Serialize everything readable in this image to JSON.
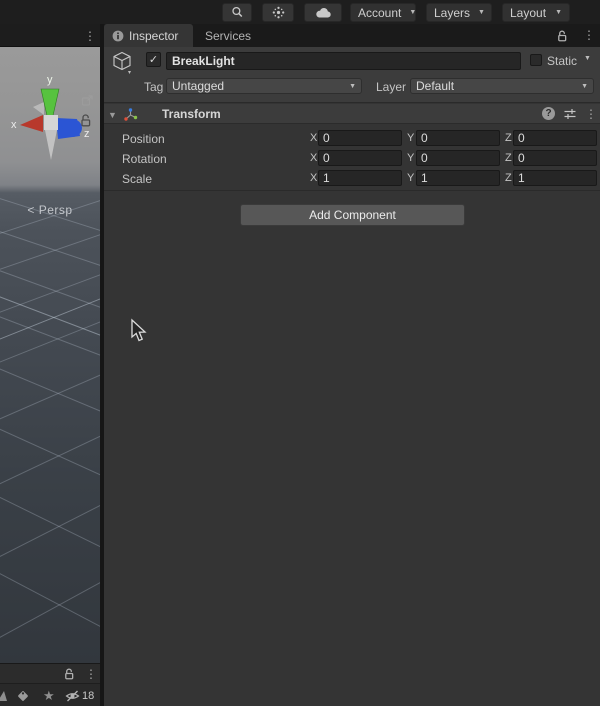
{
  "toolbar": {
    "account_label": "Account",
    "layers_label": "Layers",
    "layout_label": "Layout",
    "dropdown_arrow": "▼"
  },
  "inspector_tabs": {
    "inspector_label": "Inspector",
    "services_label": "Services",
    "kebab": "⋮"
  },
  "gameobject": {
    "check": "✓",
    "name": "BreakLight",
    "static_label": "Static",
    "tag_label": "Tag",
    "tag_value": "Untagged",
    "layer_label": "Layer",
    "layer_value": "Default"
  },
  "transform": {
    "title": "Transform",
    "foldout": "▼",
    "help_glyph": "?",
    "kebab": "⋮",
    "axes": [
      "X",
      "Y",
      "Z"
    ],
    "rows": [
      {
        "label": "Position",
        "values": [
          "0",
          "0",
          "0"
        ]
      },
      {
        "label": "Rotation",
        "values": [
          "0",
          "0",
          "0"
        ]
      },
      {
        "label": "Scale",
        "values": [
          "1",
          "1",
          "1"
        ]
      }
    ]
  },
  "add_component_label": "Add Component",
  "scene": {
    "kebab": "⋮",
    "axis_x_label": "x",
    "axis_y_label": "y",
    "axis_z_label": "z",
    "persp_prefix": "<",
    "persp_label": "Persp"
  },
  "bottom_panel": {
    "kebab": "⋮",
    "star_glyph": "★",
    "hidden_count": "18"
  },
  "colors": {
    "gizmo_x_red": "#b8392c",
    "gizmo_y_green": "#57c23f",
    "gizmo_z_blue": "#2b55d4",
    "toolbar_bg": "#1e1e1e",
    "inspector_bg": "#343434",
    "header_bg": "#3c3c3c",
    "field_bg": "#262626",
    "button_bg": "#575757"
  }
}
